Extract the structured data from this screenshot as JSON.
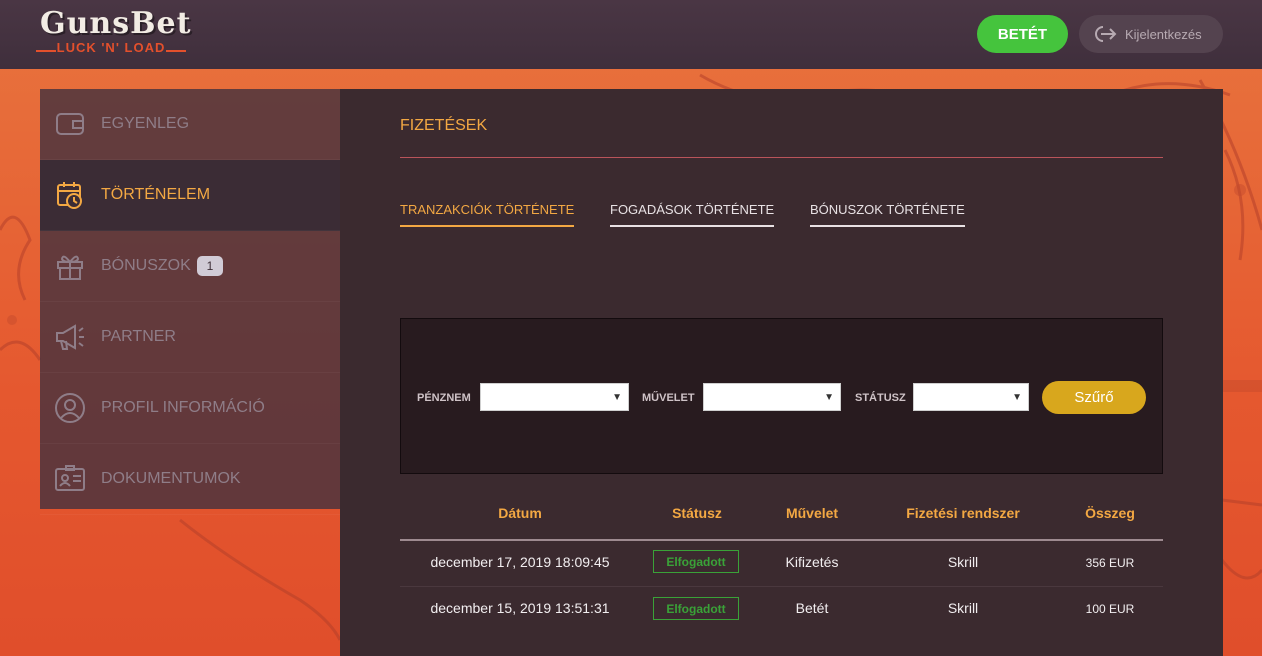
{
  "header": {
    "logo_title": "GunsBet",
    "logo_subtitle": "LUCK 'N' LOAD",
    "deposit_label": "BETÉT",
    "logout_label": "Kijelentkezés"
  },
  "sidebar": {
    "items": [
      {
        "label": "EGYENLEG",
        "icon": "wallet-icon",
        "active": false
      },
      {
        "label": "TÖRTÉNELEM",
        "icon": "calendar-clock-icon",
        "active": true
      },
      {
        "label": "BÓNUSZOK",
        "icon": "gift-icon",
        "active": false,
        "badge": "1"
      },
      {
        "label": "PARTNER",
        "icon": "megaphone-icon",
        "active": false
      },
      {
        "label": "PROFIL INFORMÁCIÓ",
        "icon": "user-icon",
        "active": false
      },
      {
        "label": "DOKUMENTUMOK",
        "icon": "id-card-icon",
        "active": false
      }
    ]
  },
  "main": {
    "title": "FIZETÉSEK",
    "tabs": [
      {
        "label": "TRANZAKCIÓK TÖRTÉNETE",
        "active": true
      },
      {
        "label": "FOGADÁSOK TÖRTÉNETE",
        "active": false
      },
      {
        "label": "BÓNUSZOK TÖRTÉNETE",
        "active": false
      }
    ],
    "filters": {
      "currency_label": "PÉNZNEM",
      "operation_label": "MŰVELET",
      "status_label": "STÁTUSZ",
      "currency_value": "",
      "operation_value": "",
      "status_value": "",
      "button_label": "Szűrő"
    },
    "table": {
      "headers": [
        "Dátum",
        "Státusz",
        "Művelet",
        "Fizetési rendszer",
        "Összeg"
      ],
      "rows": [
        {
          "date": "december 17, 2019 18:09:45",
          "status": "Elfogadott",
          "operation": "Kifizetés",
          "system": "Skrill",
          "amount": "356 EUR"
        },
        {
          "date": "december 15, 2019 13:51:31",
          "status": "Elfogadott",
          "operation": "Betét",
          "system": "Skrill",
          "amount": "100 EUR"
        }
      ]
    }
  },
  "colors": {
    "accent": "#f3a843",
    "deposit_green": "#45c43d",
    "filter_gold": "#d8a71d",
    "status_green": "#3aa238"
  }
}
